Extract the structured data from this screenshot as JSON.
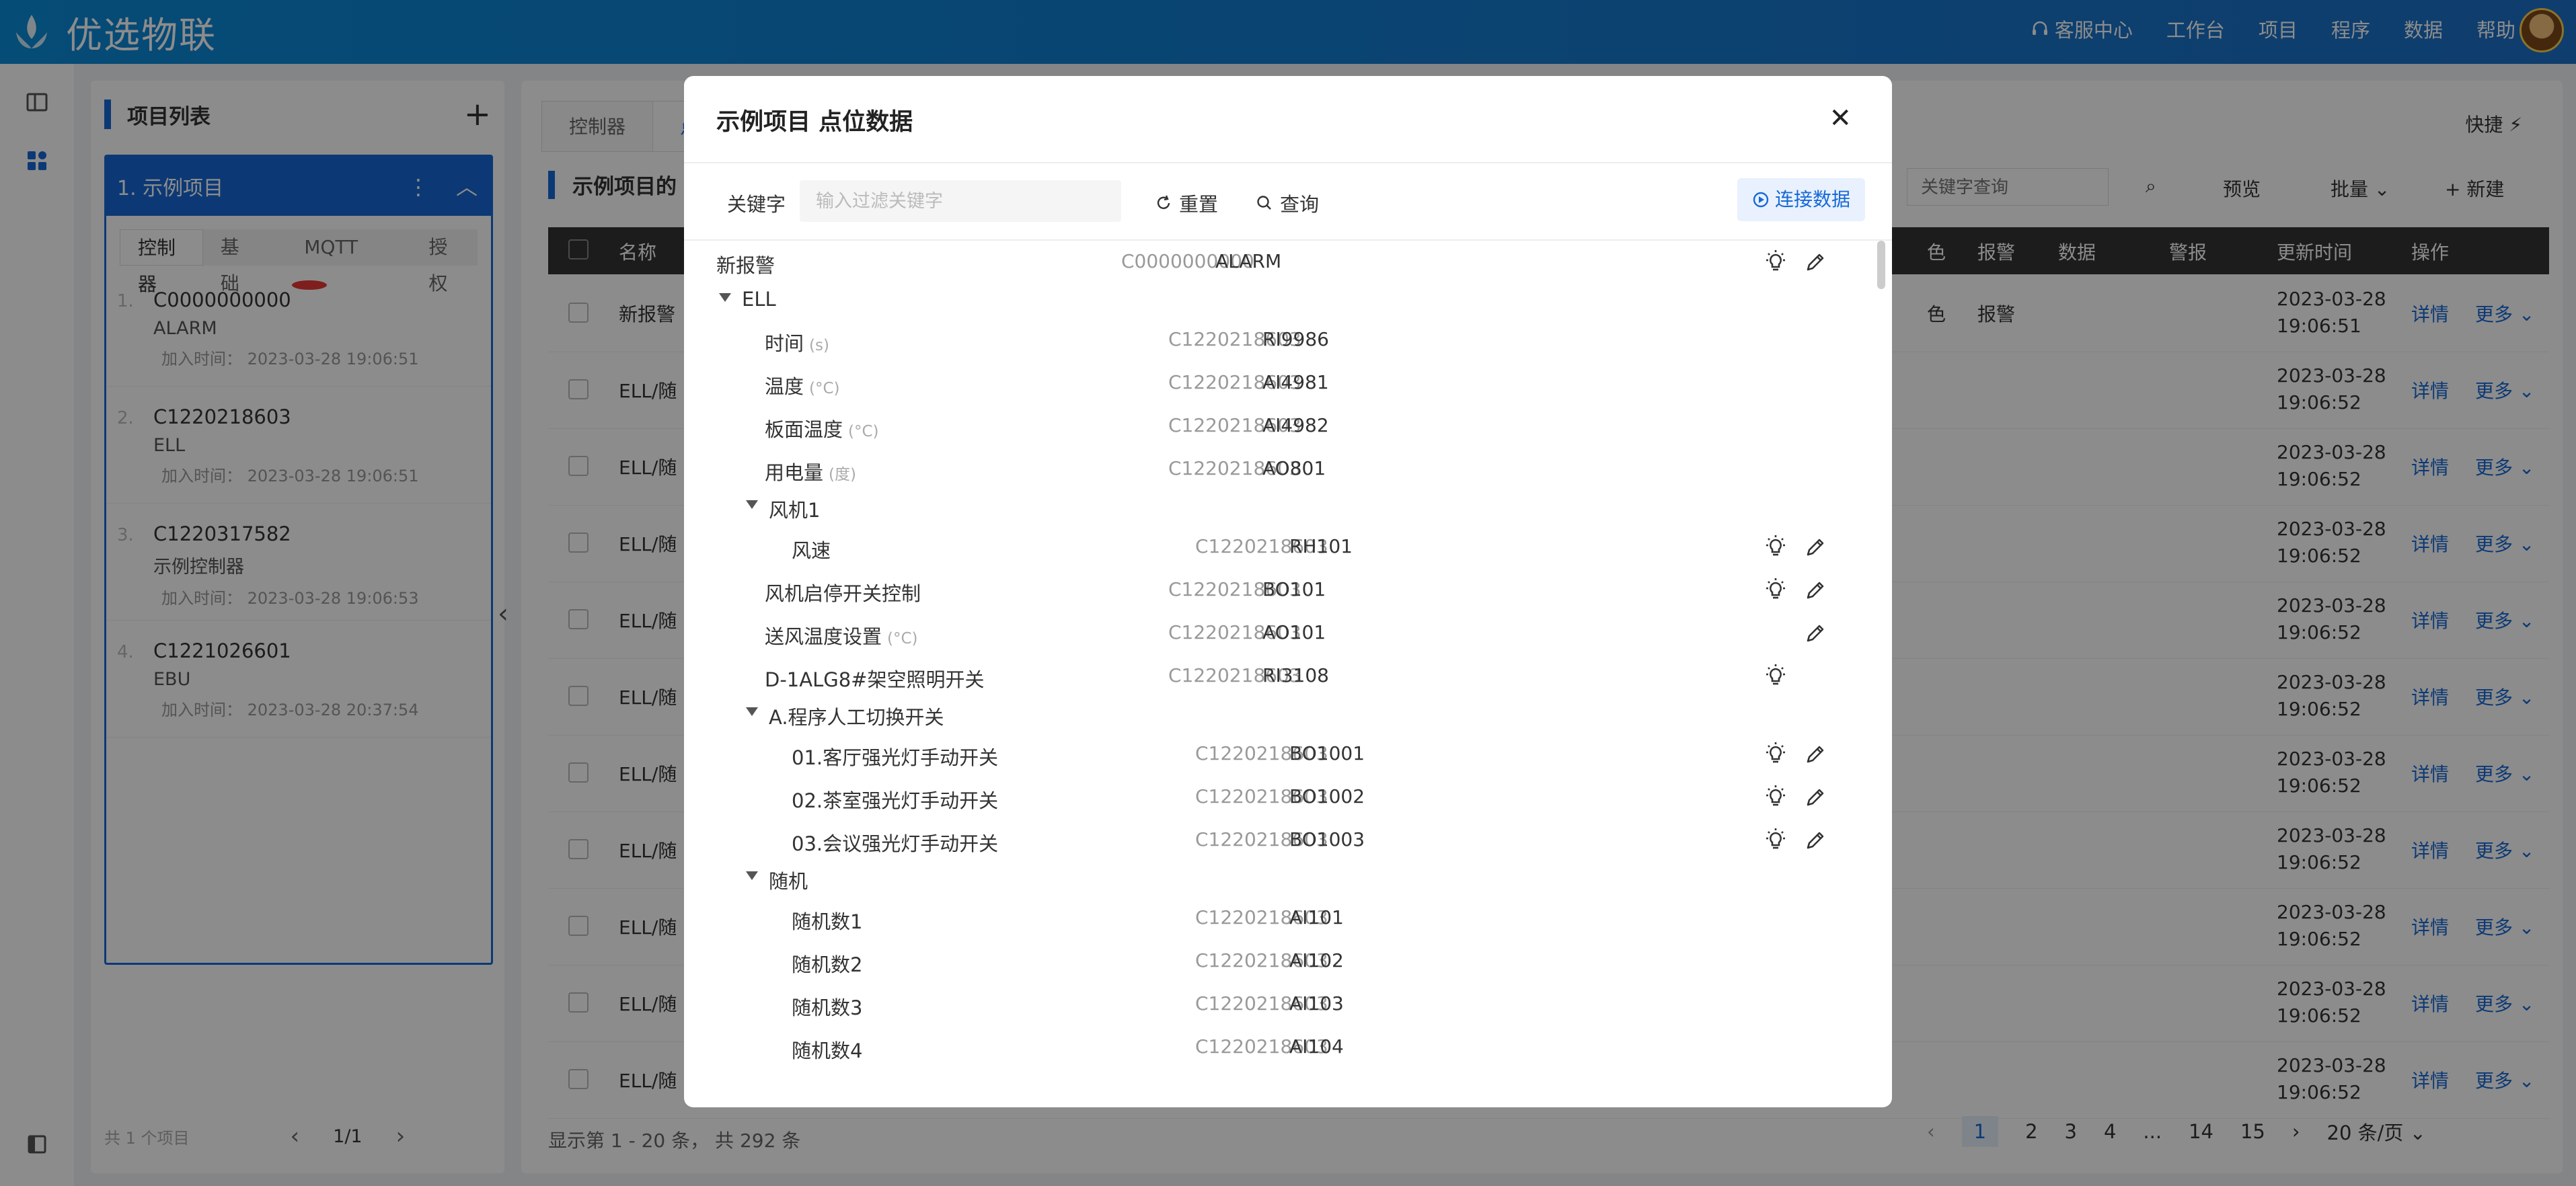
{
  "app": {
    "name": "优选物联"
  },
  "topnav": {
    "items": [
      "客服中心",
      "工作台",
      "项目",
      "程序",
      "数据",
      "帮助"
    ]
  },
  "project_panel": {
    "title": "项目列表",
    "selected": "1. 示例项目",
    "tabs": [
      "控制器",
      "基础",
      "MQTT",
      "授权"
    ],
    "controllers": [
      {
        "num": "1.",
        "code": "C0000000000",
        "name": "ALARM",
        "time": "加入时间： 2023-03-28 19:06:51"
      },
      {
        "num": "2.",
        "code": "C1220218603",
        "name": "ELL",
        "time": "加入时间： 2023-03-28 19:06:51"
      },
      {
        "num": "3.",
        "code": "C1220317582",
        "name": "示例控制器",
        "time": "加入时间： 2023-03-28 19:06:53"
      },
      {
        "num": "4.",
        "code": "C1221026601",
        "name": "EBU",
        "time": "加入时间： 2023-03-28 20:37:54"
      }
    ],
    "footer": {
      "count": "共 1 个项目",
      "page": "1/1"
    }
  },
  "main": {
    "tabs": [
      "控制器",
      "点"
    ],
    "quick": "快捷",
    "section_title": "示例项目的",
    "search_placeholder": "关键字查询",
    "buttons": {
      "preview": "预览",
      "batch": "批量",
      "new": "新建"
    },
    "columns": [
      "名称",
      "色",
      "报警",
      "数据",
      "警报",
      "更新时间",
      "操作"
    ],
    "rows": [
      {
        "name": "新报警",
        "color": "色",
        "alarm": "报警",
        "date": "2023-03-28",
        "time": "19:06:51"
      },
      {
        "name": "ELL/随",
        "date": "2023-03-28",
        "time": "19:06:52"
      },
      {
        "name": "ELL/随",
        "date": "2023-03-28",
        "time": "19:06:52"
      },
      {
        "name": "ELL/随",
        "date": "2023-03-28",
        "time": "19:06:52"
      },
      {
        "name": "ELL/随",
        "date": "2023-03-28",
        "time": "19:06:52"
      },
      {
        "name": "ELL/随",
        "date": "2023-03-28",
        "time": "19:06:52"
      },
      {
        "name": "ELL/随",
        "date": "2023-03-28",
        "time": "19:06:52"
      },
      {
        "name": "ELL/随",
        "date": "2023-03-28",
        "time": "19:06:52"
      },
      {
        "name": "ELL/随",
        "date": "2023-03-28",
        "time": "19:06:52"
      },
      {
        "name": "ELL/随",
        "date": "2023-03-28",
        "time": "19:06:52"
      },
      {
        "name": "ELL/随",
        "date": "2023-03-28",
        "time": "19:06:52"
      }
    ],
    "row_actions": {
      "detail": "详情",
      "more": "更多"
    },
    "footer_summary": "显示第 1 - 20 条， 共 292 条",
    "pages": [
      "1",
      "2",
      "3",
      "4",
      "...",
      "14",
      "15"
    ],
    "page_size": "20 条/页"
  },
  "modal": {
    "title": "示例项目 点位数据",
    "filter": {
      "label": "关键字",
      "placeholder": "输入过滤关键字",
      "reset": "重置",
      "query": "查询",
      "connect": "连接数据"
    },
    "rows": [
      {
        "type": "point",
        "label": "新报警",
        "unit": "",
        "ctrl": "C0000000000",
        "point": "ALARM",
        "bulb": true,
        "edit": true
      },
      {
        "type": "group",
        "label": "ELL"
      },
      {
        "type": "point",
        "label": "时间",
        "unit": "(s)",
        "ctrl": "C1220218603",
        "point": "RI9986",
        "bulb": false,
        "edit": false
      },
      {
        "type": "point",
        "label": "温度",
        "unit": "(°C)",
        "ctrl": "C1220218603",
        "point": "AI4981",
        "bulb": false,
        "edit": false
      },
      {
        "type": "point",
        "label": "板面温度",
        "unit": "(°C)",
        "ctrl": "C1220218603",
        "point": "AI4982",
        "bulb": false,
        "edit": false
      },
      {
        "type": "point",
        "label": "用电量",
        "unit": "(度)",
        "ctrl": "C1220218603",
        "point": "AO801",
        "bulb": false,
        "edit": false
      },
      {
        "type": "group",
        "label": "风机1"
      },
      {
        "type": "point",
        "label": "风速",
        "unit": "",
        "ctrl": "C1220218603",
        "point": "RH101",
        "bulb": true,
        "edit": true
      },
      {
        "type": "point",
        "label": "风机启停开关控制",
        "unit": "",
        "ctrl": "C1220218603",
        "point": "BO101",
        "bulb": true,
        "edit": true
      },
      {
        "type": "point",
        "label": "送风温度设置",
        "unit": "(°C)",
        "ctrl": "C1220218603",
        "point": "AO101",
        "bulb": false,
        "edit": true
      },
      {
        "type": "point",
        "label": "D-1ALG8#架空照明开关",
        "unit": "",
        "ctrl": "C1220218603",
        "point": "RI3108",
        "bulb": true,
        "edit": false
      },
      {
        "type": "group",
        "label": "A.程序人工切换开关"
      },
      {
        "type": "point",
        "label": "01.客厅强光灯手动开关",
        "unit": "",
        "ctrl": "C1220218603",
        "point": "BO1001",
        "bulb": true,
        "edit": true
      },
      {
        "type": "point",
        "label": "02.茶室强光灯手动开关",
        "unit": "",
        "ctrl": "C1220218603",
        "point": "BO1002",
        "bulb": true,
        "edit": true
      },
      {
        "type": "point",
        "label": "03.会议强光灯手动开关",
        "unit": "",
        "ctrl": "C1220218603",
        "point": "BO1003",
        "bulb": true,
        "edit": true
      },
      {
        "type": "group",
        "label": "随机"
      },
      {
        "type": "point",
        "label": "随机数1",
        "unit": "",
        "ctrl": "C1220218603",
        "point": "AI101",
        "bulb": false,
        "edit": false
      },
      {
        "type": "point",
        "label": "随机数2",
        "unit": "",
        "ctrl": "C1220218603",
        "point": "AI102",
        "bulb": false,
        "edit": false
      },
      {
        "type": "point",
        "label": "随机数3",
        "unit": "",
        "ctrl": "C1220218603",
        "point": "AI103",
        "bulb": false,
        "edit": false
      },
      {
        "type": "point",
        "label": "随机数4",
        "unit": "",
        "ctrl": "C1220218603",
        "point": "AI104",
        "bulb": false,
        "edit": false
      }
    ]
  },
  "colors": {
    "brand": "#1769d6",
    "topbar": "#0a8ad8",
    "mqtt_dot": "#e53935"
  }
}
